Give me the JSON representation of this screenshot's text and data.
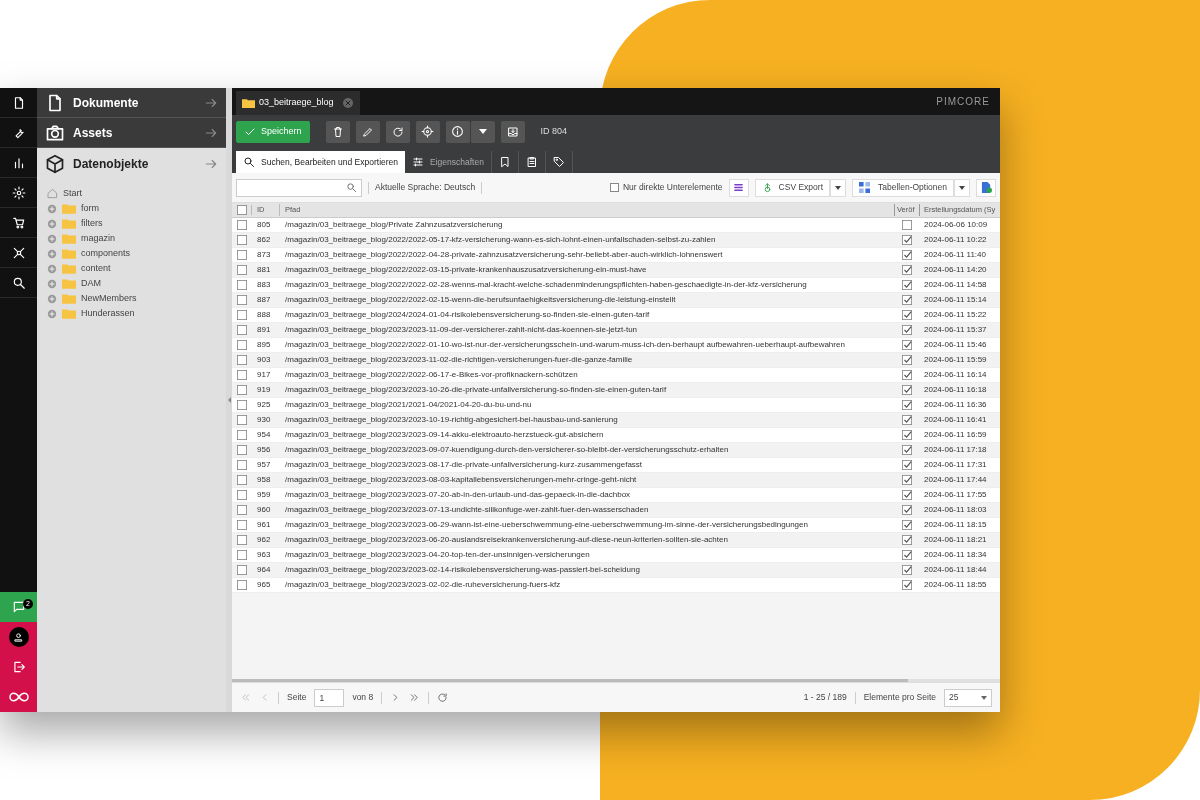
{
  "bottom_icons": [
    {
      "kind": "chat",
      "badge": "2"
    },
    {
      "kind": "user"
    },
    {
      "kind": "logout"
    },
    {
      "kind": "logo"
    }
  ],
  "nav_panels": [
    {
      "label": "Dokumente",
      "expanded": false
    },
    {
      "label": "Assets",
      "expanded": false
    },
    {
      "label": "Datenobjekte",
      "expanded": true
    }
  ],
  "tree": {
    "root": "Start",
    "children": [
      {
        "label": "form"
      },
      {
        "label": "filters"
      },
      {
        "label": "magazin"
      },
      {
        "label": "components"
      },
      {
        "label": "content"
      },
      {
        "label": "DAM"
      },
      {
        "label": "NewMembers"
      },
      {
        "label": "Hunderassen"
      }
    ]
  },
  "editor_tab": {
    "label": "03_beitraege_blog"
  },
  "brand": "PIMCORE",
  "toolbar": {
    "save": "Speichern",
    "id_label": "ID 804"
  },
  "sub_tabs": [
    {
      "label": "Suchen, Bearbeiten und Exportieren",
      "selected": true
    },
    {
      "label": "Eigenschaften",
      "selected": false
    },
    {
      "selected": false
    },
    {
      "selected": false
    },
    {
      "selected": false
    }
  ],
  "grid_toolbar": {
    "language": "Aktuelle Sprache: Deutsch",
    "only_direct": {
      "label": "Nur direkte Unterelemente",
      "checked": false
    },
    "csv": "CSV Export",
    "table_options": "Tabellen-Optionen"
  },
  "table": {
    "select_all": {
      "checked": false
    },
    "columns": [
      "ID",
      "Pfad",
      "Veröf",
      "Erstellungsdatum (Sy"
    ],
    "rows": [
      {
        "id": "805",
        "selected": false,
        "path": "/magazin/03_beitraege_blog/Private Zahnzusatzversicherung",
        "published": false,
        "date": "2024-06-06 10:09"
      },
      {
        "id": "862",
        "selected": false,
        "path": "/magazin/03_beitraege_blog/2022/2022-05-17-kfz-versicherung-wann-es-sich-lohnt-einen-unfallschaden-selbst-zu-zahlen",
        "published": true,
        "date": "2024-06-11 10:22"
      },
      {
        "id": "873",
        "selected": false,
        "path": "/magazin/03_beitraege_blog/2022/2022-04-28-private-zahnzusatzversicherung-sehr-beliebt-aber-auch-wirklich-lohnenswert",
        "published": true,
        "date": "2024-06-11 11:40"
      },
      {
        "id": "881",
        "selected": false,
        "path": "/magazin/03_beitraege_blog/2022/2022-03-15-private-krankenhauszusatzversicherung-ein-must-have",
        "published": true,
        "date": "2024-06-11 14:20"
      },
      {
        "id": "883",
        "selected": false,
        "path": "/magazin/03_beitraege_blog/2022/2022-02-28-wenns-mal-kracht-welche-schadenminderungspflichten-haben-geschaedigte-in-der-kfz-versicherung",
        "published": true,
        "date": "2024-06-11 14:58"
      },
      {
        "id": "887",
        "selected": false,
        "path": "/magazin/03_beitraege_blog/2022/2022-02-15-wenn-die-berufsunfaehigkeitsversicherung-die-leistung-einstellt",
        "published": true,
        "date": "2024-06-11 15:14"
      },
      {
        "id": "888",
        "selected": false,
        "path": "/magazin/03_beitraege_blog/2024/2024-01-04-risikolebensversicherung-so-finden-sie-einen-guten-tarif",
        "published": true,
        "date": "2024-06-11 15:22"
      },
      {
        "id": "891",
        "selected": false,
        "path": "/magazin/03_beitraege_blog/2023/2023-11-09-der-versicherer-zahlt-nicht-das-koennen-sie-jetzt-tun",
        "published": true,
        "date": "2024-06-11 15:37"
      },
      {
        "id": "895",
        "selected": false,
        "path": "/magazin/03_beitraege_blog/2022/2022-01-10-wo-ist-nur-der-versicherungsschein-und-warum-muss-ich-den-berhaupt aufbewahren-ueberhaupt-aufbewahren",
        "published": true,
        "date": "2024-06-11 15:46"
      },
      {
        "id": "903",
        "selected": false,
        "path": "/magazin/03_beitraege_blog/2023/2023-11-02-die-richtigen-versicherungen-fuer-die-ganze-familie",
        "published": true,
        "date": "2024-06-11 15:59"
      },
      {
        "id": "917",
        "selected": false,
        "path": "/magazin/03_beitraege_blog/2022/2022-06-17-e-Bikes-vor-profiknackern-schützen",
        "published": true,
        "date": "2024-06-11 16:14"
      },
      {
        "id": "919",
        "selected": false,
        "path": "/magazin/03_beitraege_blog/2023/2023-10-26-die-private-unfallversicherung-so-finden-sie-einen-guten-tarif",
        "published": true,
        "date": "2024-06-11 16:18"
      },
      {
        "id": "925",
        "selected": false,
        "path": "/magazin/03_beitraege_blog/2021/2021-04/2021-04-20-du-bu-und-nu",
        "published": true,
        "date": "2024-06-11 16:36"
      },
      {
        "id": "930",
        "selected": false,
        "path": "/magazin/03_beitraege_blog/2023/2023-10-19-richtig-abgesichert-bei-hausbau-und-sanierung",
        "published": true,
        "date": "2024-06-11 16:41"
      },
      {
        "id": "954",
        "selected": false,
        "path": "/magazin/03_beitraege_blog/2023/2023-09-14-akku-elektroauto-herzstueck-gut-absichern",
        "published": true,
        "date": "2024-06-11 16:59"
      },
      {
        "id": "956",
        "selected": false,
        "path": "/magazin/03_beitraege_blog/2023/2023-09-07-kuendigung-durch-den-versicherer-so-bleibt-der-versicherungsschutz-erhalten",
        "published": true,
        "date": "2024-06-11 17:18"
      },
      {
        "id": "957",
        "selected": false,
        "path": "/magazin/03_beitraege_blog/2023/2023-08-17-die-private-unfallversicherung-kurz-zusammengefasst",
        "published": true,
        "date": "2024-06-11 17:31"
      },
      {
        "id": "958",
        "selected": false,
        "path": "/magazin/03_beitraege_blog/2023/2023-08-03-kapitallebensversicherungen-mehr-cringe-geht-nicht",
        "published": true,
        "date": "2024-06-11 17:44"
      },
      {
        "id": "959",
        "selected": false,
        "path": "/magazin/03_beitraege_blog/2023/2023-07-20-ab-in-den-urlaub-und-das-gepaeck-in-die-dachbox",
        "published": true,
        "date": "2024-06-11 17:55"
      },
      {
        "id": "960",
        "selected": false,
        "path": "/magazin/03_beitraege_blog/2023/2023-07-13-undichte-silikonfuge-wer-zahlt-fuer-den-wasserschaden",
        "published": true,
        "date": "2024-06-11 18:03"
      },
      {
        "id": "961",
        "selected": false,
        "path": "/magazin/03_beitraege_blog/2023/2023-06-29-wann-ist-eine-ueberschwemmung-eine-ueberschwemmung-im-sinne-der-versicherungsbedingungen",
        "published": true,
        "date": "2024-06-11 18:15"
      },
      {
        "id": "962",
        "selected": false,
        "path": "/magazin/03_beitraege_blog/2023/2023-06-20-auslandsreisekrankenversicherung-auf-diese-neun-kriterien-sollten-sie-achten",
        "published": true,
        "date": "2024-06-11 18:21"
      },
      {
        "id": "963",
        "selected": false,
        "path": "/magazin/03_beitraege_blog/2023/2023-04-20-top-ten-der-unsinnigen-versicherungen",
        "published": true,
        "date": "2024-06-11 18:34"
      },
      {
        "id": "964",
        "selected": false,
        "path": "/magazin/03_beitraege_blog/2023/2023-02-14-risikolebensversicherung-was-passiert-bei-scheidung",
        "published": true,
        "date": "2024-06-11 18:44"
      },
      {
        "id": "965",
        "selected": false,
        "path": "/magazin/03_beitraege_blog/2023/2023-02-02-die-ruheversicherung-fuers-kfz",
        "published": true,
        "date": "2024-06-11 18:55"
      }
    ]
  },
  "pager": {
    "page_label": "Seite",
    "page": "1",
    "of": "von 8",
    "range": "1 - 25 / 189",
    "per_page_label": "Elemente pro Seite",
    "per_page": "25"
  }
}
